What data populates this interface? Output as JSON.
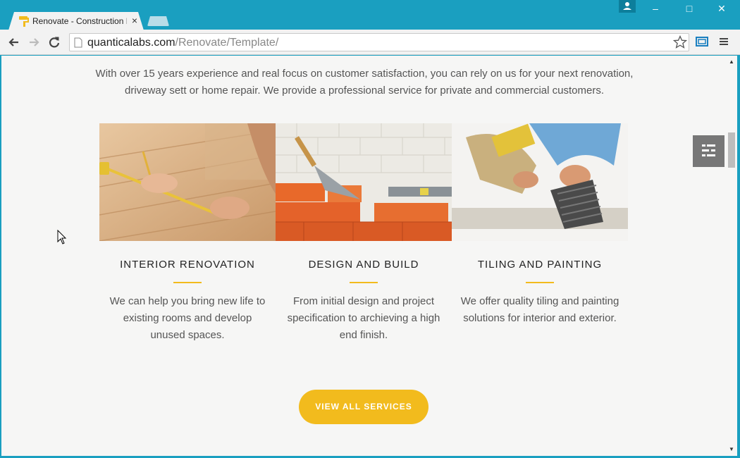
{
  "browser": {
    "tab_title": "Renovate - Construction Renovation",
    "tab_close": "×",
    "window_controls": {
      "minimize": "–",
      "maximize": "□",
      "close": "✕"
    },
    "url_host": "quanticalabs.com",
    "url_path": "/Renovate/Template/"
  },
  "page": {
    "intro": "With over 15 years experience and real focus on customer satisfaction, you can rely on us for your next renovation, driveway sett or home repair. We provide a professional service for private and commercial customers.",
    "services": [
      {
        "title": "INTERIOR RENOVATION",
        "description": "We can help you bring new life to existing rooms and develop unused spaces."
      },
      {
        "title": "DESIGN AND BUILD",
        "description": "From initial design and project specification to archieving a high end finish."
      },
      {
        "title": "TILING AND PAINTING",
        "description": "We offer quality tiling and painting solutions for interior and exterior."
      }
    ],
    "cta_label": "VIEW ALL SERVICES"
  },
  "colors": {
    "accent": "#f2bb1d",
    "chrome": "#1a9fc0",
    "page_bg": "#f6f6f5"
  },
  "icons": [
    "paint-roller-favicon-icon",
    "back-arrow-icon",
    "forward-arrow-icon",
    "reload-icon",
    "page-icon",
    "star-icon",
    "cast-icon",
    "menu-icon",
    "profile-icon",
    "settings-list-icon",
    "mouse-cursor-icon"
  ]
}
